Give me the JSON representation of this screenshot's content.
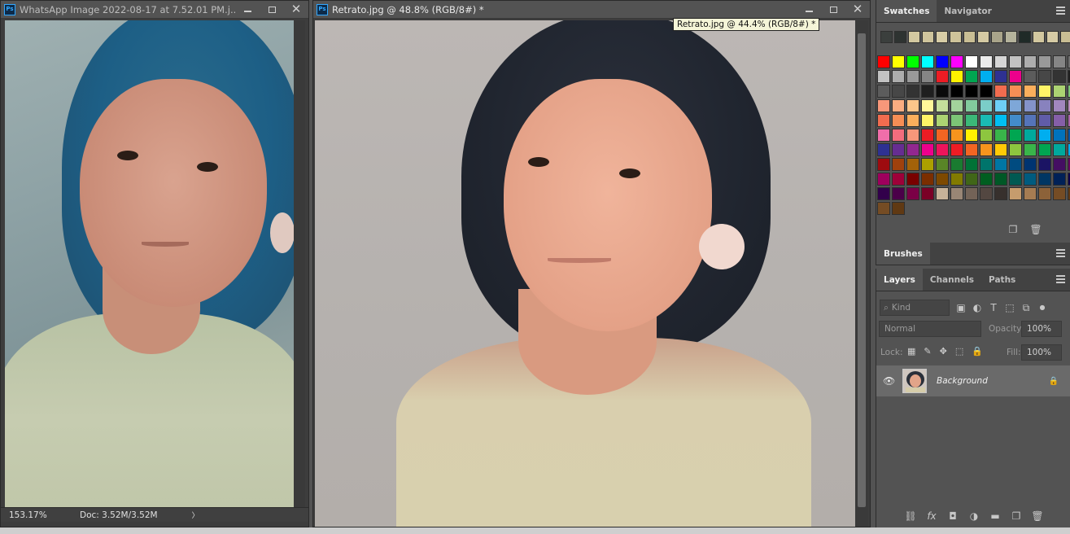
{
  "app": {
    "icon_text": "Ps"
  },
  "window1": {
    "title": "WhatsApp Image 2022-08-17 at 7.52.01 PM.j...",
    "zoom": "153.17%",
    "doc_info": "Doc: 3.52M/3.52M",
    "status_arrow": "〉"
  },
  "window2": {
    "title": "Retrato.jpg @ 48.8% (RGB/8#) *",
    "tooltip": "Retrato.jpg @ 44.4% (RGB/8#) *"
  },
  "swatches_panel": {
    "tabs": [
      {
        "label": "Swatches"
      },
      {
        "label": "Navigator"
      }
    ],
    "recent": [
      "#3b3f3d",
      "#2e3331",
      "#d3c8a0",
      "#cfc49c",
      "#d8cda6",
      "#cec39a",
      "#c9be94",
      "#d4c9a3",
      "#a9a48a",
      "#b5b39c",
      "#1f2a27",
      "#d2c79f",
      "#d6cba5",
      "#c8bd93"
    ],
    "colors": [
      "#ff0000",
      "#ffff00",
      "#00ff00",
      "#00ffff",
      "#0000ff",
      "#ff00ff",
      "#ffffff",
      "#ebebeb",
      "#d6d6d6",
      "#c2c2c2",
      "#adadad",
      "#999999",
      "#858585",
      "#707070",
      "#c2c2c2",
      "#adadad",
      "#999999",
      "#858585",
      "#ed1c24",
      "#fff200",
      "#00a651",
      "#00aeef",
      "#2e3192",
      "#ec008c",
      "#5c5c5c",
      "#474747",
      "#333333",
      "#1f1f1f",
      "#5c5c5c",
      "#474747",
      "#333333",
      "#1f1f1f",
      "#0a0a0a",
      "#000000",
      "#000000",
      "#000000",
      "#f26c4f",
      "#f68e55",
      "#fbaf5c",
      "#fff467",
      "#acd372",
      "#7cc576",
      "#f7977a",
      "#f9ad81",
      "#fdc68a",
      "#fff79a",
      "#c4df9b",
      "#a3d39c",
      "#82ca9d",
      "#7bcdc8",
      "#6ecff6",
      "#7ea7d8",
      "#8493ca",
      "#8882be",
      "#a187be",
      "#bc8dbf",
      "#f26c4f",
      "#f68e55",
      "#fbaf5c",
      "#fff467",
      "#acd372",
      "#7cc576",
      "#3bb878",
      "#1abbb4",
      "#00bff3",
      "#438ccb",
      "#5574b9",
      "#605ca8",
      "#855fa8",
      "#a763a8",
      "#f06eaa",
      "#f26d7d",
      "#f7977a",
      "#ed1c24",
      "#f26522",
      "#f7941d",
      "#fff200",
      "#8dc63f",
      "#39b54a",
      "#00a651",
      "#00a99d",
      "#00aeef",
      "#0072bc",
      "#0054a6",
      "#2e3192",
      "#662d91",
      "#92278f",
      "#ec008c",
      "#ed145b",
      "#ed1c24",
      "#f26522",
      "#f7941d",
      "#ffca05",
      "#8dc63f",
      "#39b54a",
      "#00a651",
      "#00a99d",
      "#00aeef",
      "#9e0b0f",
      "#a0410d",
      "#a36209",
      "#aba000",
      "#598527",
      "#1a7b30",
      "#007236",
      "#00746b",
      "#0076a3",
      "#004b80",
      "#003471",
      "#1b1464",
      "#440e62",
      "#630460",
      "#9e005d",
      "#9e0039",
      "#790000",
      "#7b2e00",
      "#7d4900",
      "#827b00",
      "#406618",
      "#005e20",
      "#005826",
      "#005952",
      "#005b7f",
      "#003663",
      "#002157",
      "#0d004c",
      "#32004b",
      "#4b0049",
      "#7b0046",
      "#7a0026",
      "#c7b299",
      "#998675",
      "#736357",
      "#534741",
      "#37302d",
      "#c69c6d",
      "#a67c52",
      "#8c6239",
      "#754c24",
      "#603913"
    ],
    "extra": [
      "#754c24",
      "#603913"
    ],
    "footer_icons": [
      "new-swatch-icon",
      "delete-icon"
    ]
  },
  "brushes_panel": {
    "tab": "Brushes"
  },
  "layers_panel": {
    "tabs": [
      {
        "label": "Layers"
      },
      {
        "label": "Channels"
      },
      {
        "label": "Paths"
      }
    ],
    "filter_placeholder": "Kind",
    "blend_mode": "Normal",
    "opacity_label": "Opacity:",
    "opacity_value": "100%",
    "lock_label": "Lock:",
    "fill_label": "Fill:",
    "fill_value": "100%",
    "layers": [
      {
        "name": "Background",
        "locked": true,
        "visible": true
      }
    ],
    "footer_icons": [
      "link-icon",
      "fx-icon",
      "mask-icon",
      "adjustment-icon",
      "group-icon",
      "new-layer-icon",
      "delete-icon"
    ]
  }
}
